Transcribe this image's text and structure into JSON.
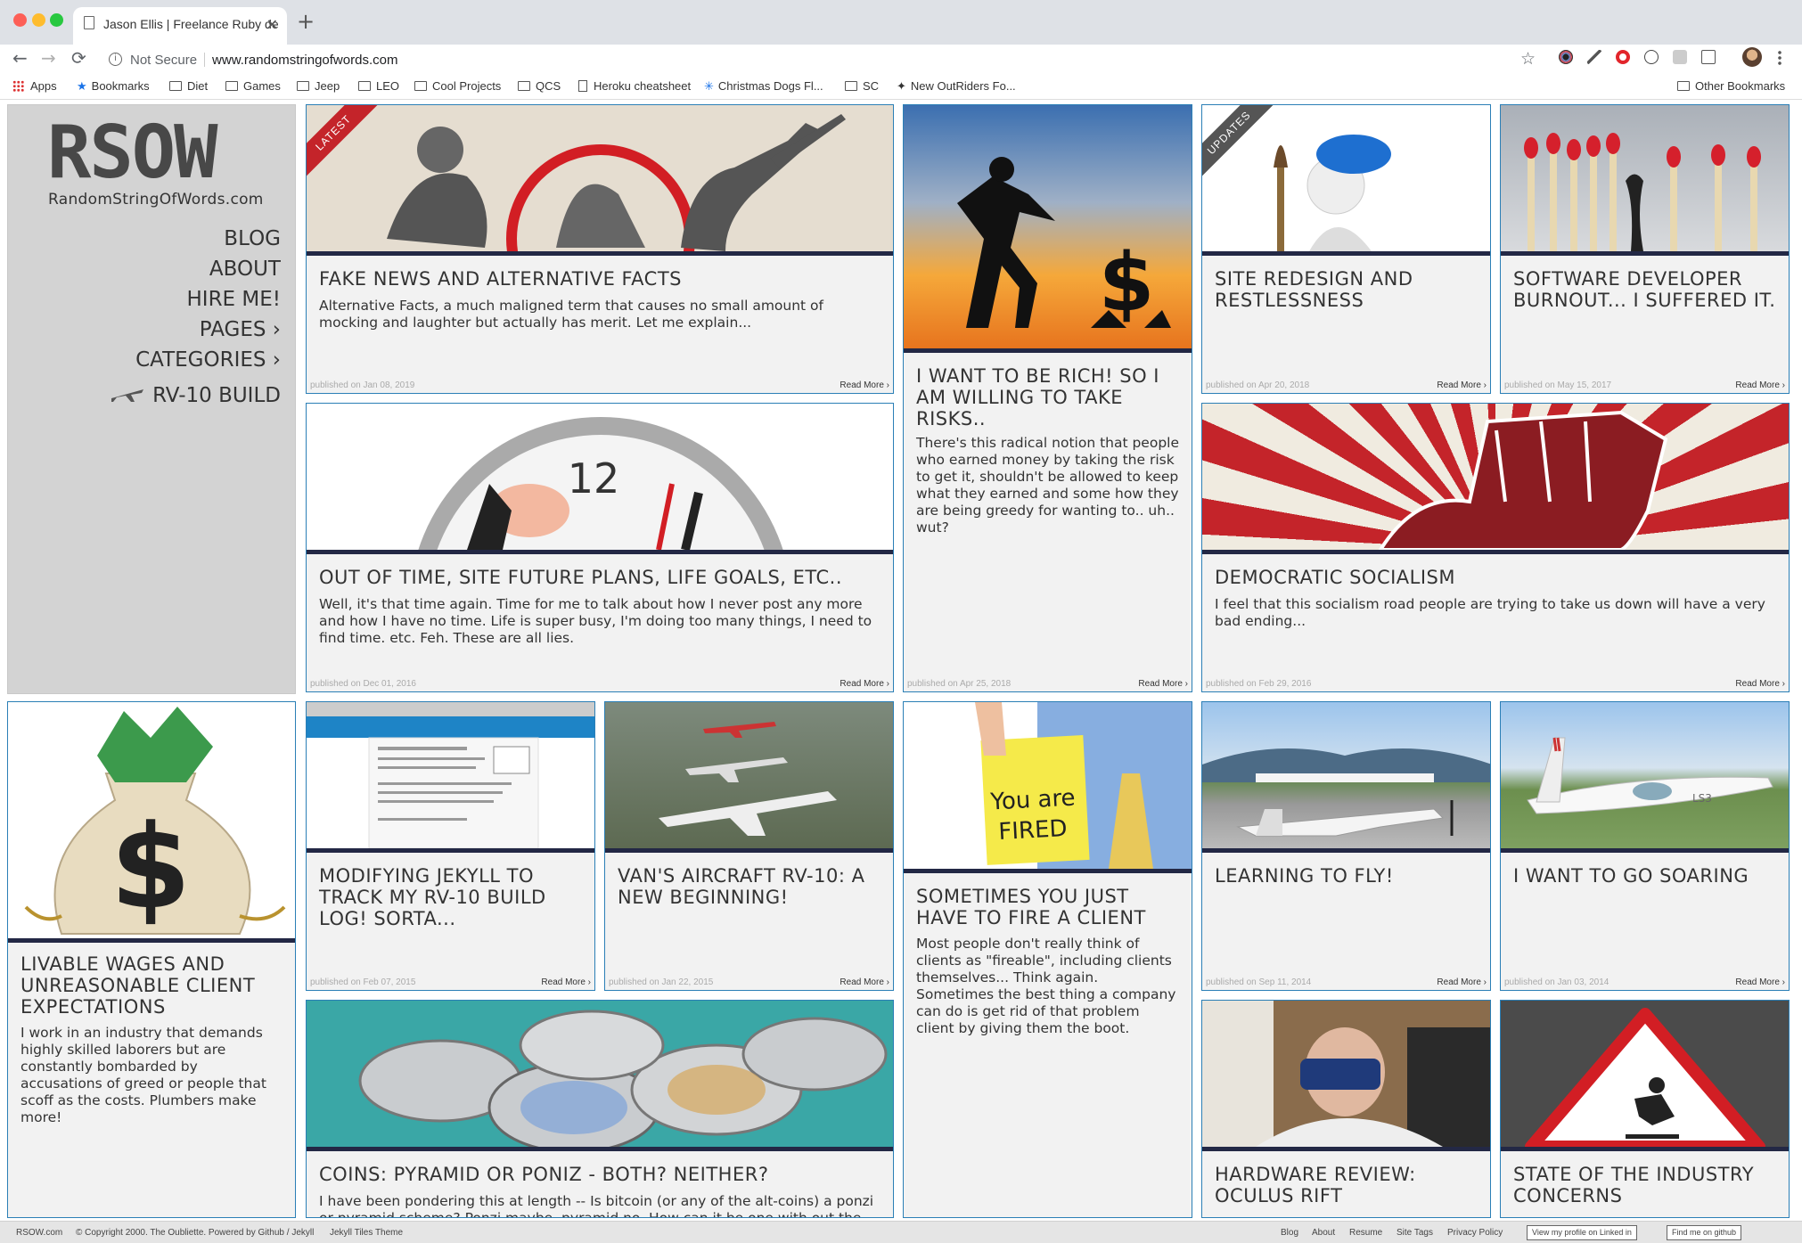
{
  "browser": {
    "tab_title": "Jason Ellis | Freelance Ruby de",
    "tab_close": "✕",
    "new_tab": "+",
    "security": "Not Secure",
    "url": "www.randomstringofwords.com",
    "back": "←",
    "forward": "→",
    "reload": "⟳",
    "star": "☆"
  },
  "bookmarks": {
    "apps": "Apps",
    "items": [
      "Bookmarks",
      "Diet",
      "Games",
      "Jeep",
      "LEO",
      "Cool Projects",
      "QCS",
      "Heroku cheatsheet",
      "Christmas Dogs Fl...",
      "SC",
      "New OutRiders Fo..."
    ],
    "other": "Other Bookmarks"
  },
  "site": {
    "logo": "RSOW",
    "logo_sub": "RandomStringOfWords.com",
    "nav": [
      "Blog",
      "About",
      "Hire Me!",
      "Pages ›",
      "Categories ›",
      "RV-10 Build"
    ]
  },
  "posts": [
    {
      "title": "Fake News and Alternative Facts",
      "excerpt": "Alternative Facts, a much maligned term that causes no small amount of mocking and laughter but actually has merit. Let me explain...",
      "date": "published on Jan 08, 2019",
      "more": "Read More ›",
      "ribbon": "LATEST"
    },
    {
      "title": "I want to be rich! So I am willing to take risks..",
      "excerpt": "There's this radical notion that people who earned money by taking the risk to get it, shouldn't be allowed to keep what they earned and some how they are being greedy for wanting to.. uh.. wut?",
      "date": "published on Apr 25, 2018",
      "more": "Read More ›"
    },
    {
      "title": "Site Redesign and Restlessness",
      "excerpt": "",
      "date": "published on Apr 20, 2018",
      "more": "Read More ›",
      "ribbon": "UPDATES"
    },
    {
      "title": "Software Developer Burnout... I suffered it.",
      "excerpt": "",
      "date": "published on May 15, 2017",
      "more": "Read More ›"
    },
    {
      "title": "Out of time, site future plans, life goals, etc..",
      "excerpt": "Well, it's that time again. Time for me to talk about how I never post any more and how I have no time. Life is super busy, I'm doing too many things, I need to find time. etc. Feh. These are all lies.",
      "date": "published on Dec 01, 2016",
      "more": "Read More ›"
    },
    {
      "title": "Democratic Socialism",
      "excerpt": "I feel that this socialism road people are trying to take us down will have a very bad ending...",
      "date": "published on Feb 29, 2016",
      "more": "Read More ›"
    },
    {
      "title": "Livable Wages and Unreasonable Client Expectations",
      "excerpt": "I work in an industry that demands highly skilled laborers but are constantly bombarded by accusations of greed or people that scoff as the costs. Plumbers make more!",
      "date": "",
      "more": ""
    },
    {
      "title": "Modifying Jekyll to track my RV-10 build log! Sorta...",
      "excerpt": "",
      "date": "published on Feb 07, 2015",
      "more": "Read More ›"
    },
    {
      "title": "Van's Aircraft RV-10: A New Beginning!",
      "excerpt": "",
      "date": "published on Jan 22, 2015",
      "more": "Read More ›"
    },
    {
      "title": "Sometimes you just have to fire a client",
      "excerpt": "Most people don't really think of clients as \"fireable\", including clients themselves... Think again. Sometimes the best thing a company can do is get rid of that problem client by giving them the boot.",
      "date": "",
      "more": ""
    },
    {
      "title": "Learning to Fly!",
      "excerpt": "",
      "date": "published on Sep 11, 2014",
      "more": "Read More ›"
    },
    {
      "title": "I want to go Soaring",
      "excerpt": "",
      "date": "published on Jan 03, 2014",
      "more": "Read More ›"
    },
    {
      "title": "Coins: Pyramid or Poniz - Both? Neither?",
      "excerpt": "I have been pondering this at length -- Is bitcoin (or any of the alt-coins) a ponzi or pyramid scheme? Ponzi maybe, pyramid no. How can it be one with out the other?",
      "date": "",
      "more": ""
    },
    {
      "title": "Hardware Review: Oculus Rift",
      "excerpt": "",
      "date": "",
      "more": ""
    },
    {
      "title": "State of the Industry Concerns",
      "excerpt": "",
      "date": "",
      "more": ""
    }
  ],
  "img_text": {
    "clock": "12",
    "fired": "You are\nFIRED",
    "glider": "LS3"
  },
  "footer": {
    "site": "RSOW.com",
    "copy": "© Copyright 2000. The Oubliette. Powered by Github / Jekyll",
    "theme": "Jekyll Tiles Theme",
    "links": [
      "Blog",
      "About",
      "Resume",
      "Site Tags",
      "Privacy Policy"
    ],
    "linkedin": "View my profile on Linked in",
    "github": "Find me on github"
  }
}
